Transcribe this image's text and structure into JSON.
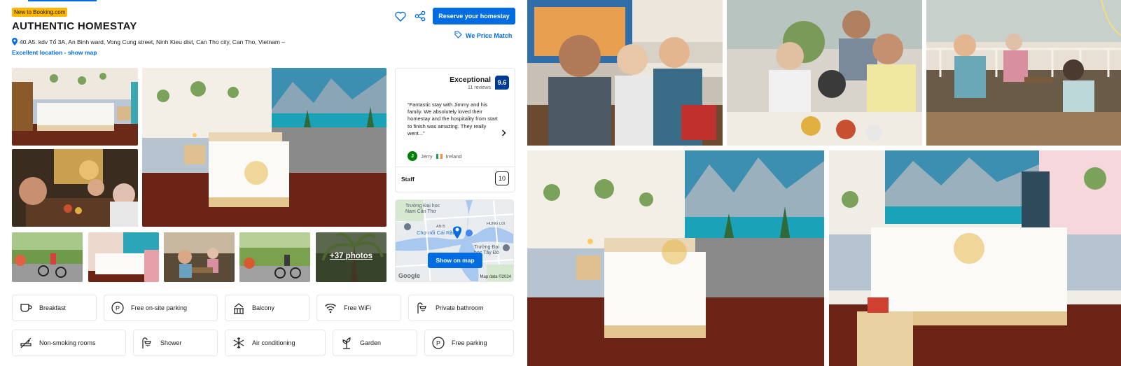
{
  "header": {
    "badge": "New to Booking.com",
    "title": "AUTHENTIC HOMESTAY",
    "address": "40.A5. kdv Tổ 3A, An Binh ward, Vong Cung street, Ninh Kieu dist, Can Tho city, Can Tho, Vietnam –",
    "location_link": "Excellent location - show map",
    "reserve_label": "Reserve your homestay",
    "price_match": "We Price Match"
  },
  "icons": {
    "save": "heart-icon",
    "share": "share-icon",
    "price_match": "tag-icon",
    "location": "pin-icon"
  },
  "review": {
    "label": "Exceptional",
    "count": "11 reviews",
    "score": "9.6",
    "quote": "“Fantastic stay with Jimmy and his family. We absolutely loved their homestay and the hospitality from start to finish was amazing. They really went...”",
    "author_initial": "J",
    "author": "Jerry",
    "country": "Ireland",
    "category": "Staff",
    "category_score": "10"
  },
  "map": {
    "button": "Show on map",
    "label_top": "Trường Đại học\nNam Cần Thơ",
    "label_mid": "Chợ nổi Cái Răng",
    "label_right": "Trường Đại\nhọc Tây Đô",
    "label_road": "HUNG LOI",
    "label_small": "AN B",
    "google": "Google",
    "map_data": "Map data ©2024"
  },
  "gallery": {
    "more_label": "+37 photos"
  },
  "facilities": [
    {
      "label": "Breakfast",
      "icon": "coffee-cup-icon"
    },
    {
      "label": "Free on-site parking",
      "icon": "parking-icon"
    },
    {
      "label": "Balcony",
      "icon": "balcony-icon"
    },
    {
      "label": "Free WiFi",
      "icon": "wifi-icon"
    },
    {
      "label": "Private bathroom",
      "icon": "shower-icon"
    },
    {
      "label": "Non-smoking rooms",
      "icon": "no-smoking-icon"
    },
    {
      "label": "Shower",
      "icon": "shower-icon"
    },
    {
      "label": "Air conditioning",
      "icon": "snowflake-icon"
    },
    {
      "label": "Garden",
      "icon": "garden-icon"
    },
    {
      "label": "Free parking",
      "icon": "parking-icon"
    }
  ],
  "colors": {
    "brand_blue": "#006ce4",
    "score_blue": "#003b95",
    "badge_yellow": "#ffb700",
    "avatar_green": "#008009"
  }
}
